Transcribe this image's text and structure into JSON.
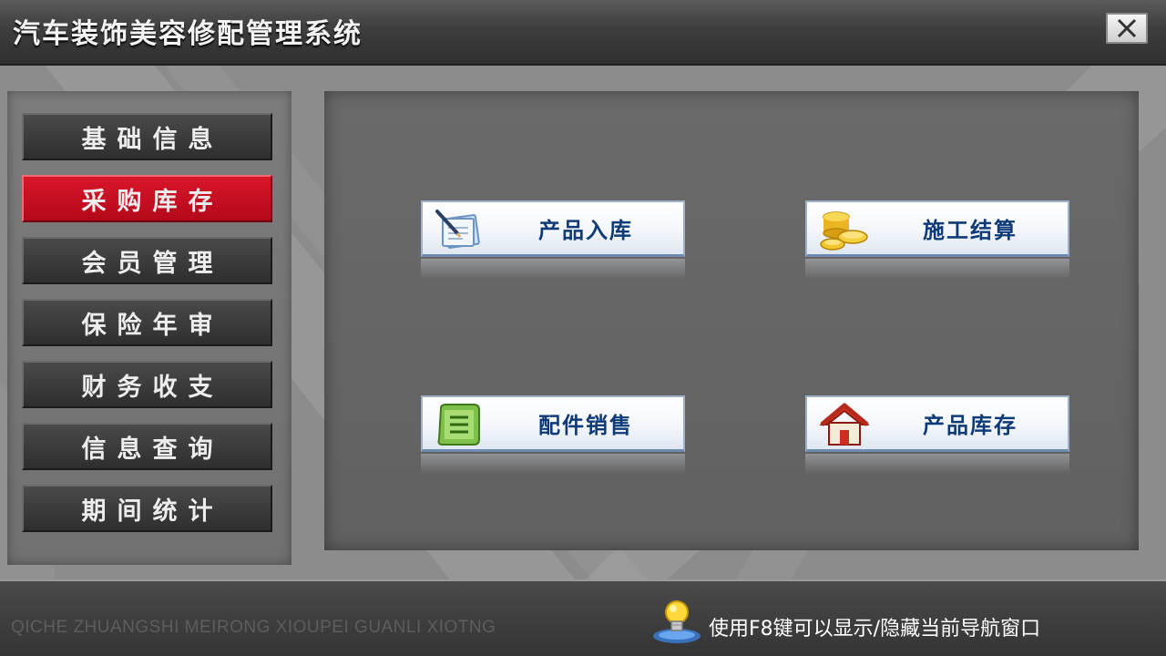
{
  "window": {
    "title": "汽车装饰美容修配管理系统",
    "close_icon": "close-icon"
  },
  "nav": {
    "items": [
      {
        "label": "基础信息",
        "active": false
      },
      {
        "label": "采购库存",
        "active": true
      },
      {
        "label": "会员管理",
        "active": false
      },
      {
        "label": "保险年审",
        "active": false
      },
      {
        "label": "财务收支",
        "active": false
      },
      {
        "label": "信息查询",
        "active": false
      },
      {
        "label": "期间统计",
        "active": false
      }
    ],
    "active_color": "#c8102e"
  },
  "content": {
    "buttons": [
      {
        "label": "产品入库",
        "icon": "document-pen-icon"
      },
      {
        "label": "施工结算",
        "icon": "coins-icon"
      },
      {
        "label": "配件销售",
        "icon": "receipt-list-icon"
      },
      {
        "label": "产品库存",
        "icon": "house-icon"
      }
    ]
  },
  "footer": {
    "pinyin": "QICHE ZHUANGSHI MEIRONG XIOUPEI GUANLI XIOTNG",
    "tip_icon": "lightbulb-icon",
    "tip": "使用F8键可以显示/隐藏当前导航窗口"
  }
}
